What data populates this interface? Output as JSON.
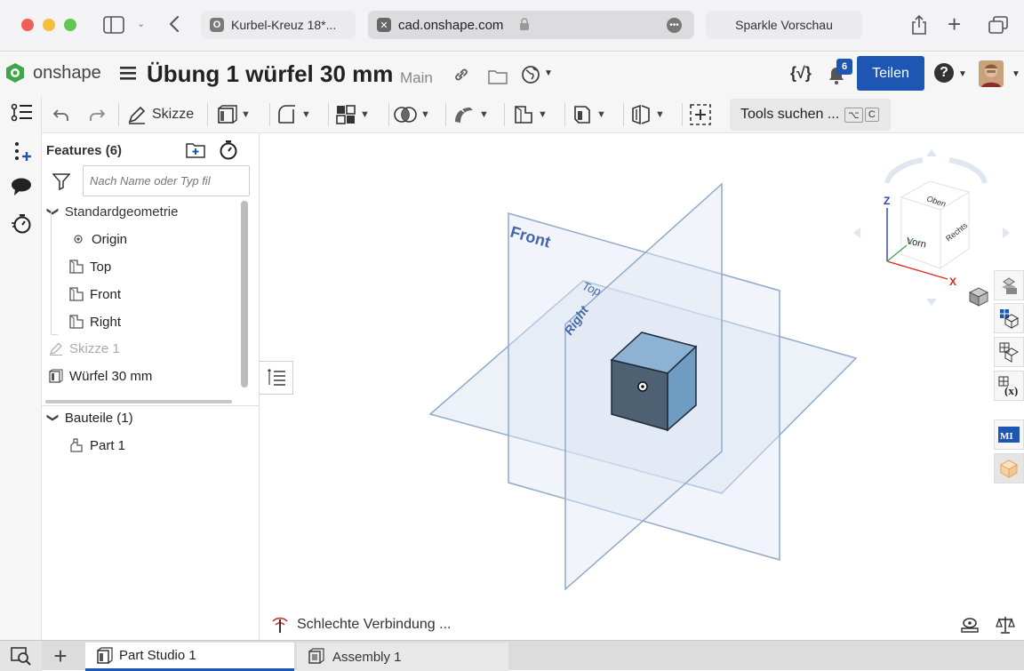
{
  "browser": {
    "tab1_label": "Kurbel-Kreuz 18*...",
    "tab1_favicon": "O",
    "address": "cad.onshape.com",
    "tab3_label": "Sparkle Vorschau",
    "favicon_x": "✕"
  },
  "header": {
    "logo_text": "onshape",
    "doc_title": "Übung 1 würfel 30 mm",
    "branch": "Main",
    "notification_count": "6",
    "share_label": "Teilen",
    "help_label": "?"
  },
  "toolbar": {
    "sketch_label": "Skizze",
    "search_tools_label": "Tools suchen ...",
    "shortcut_key_1": "⌥",
    "shortcut_key_2": "C"
  },
  "features": {
    "title": "Features (6)",
    "filter_placeholder": "Nach Name oder Typ fil",
    "default_geometry_label": "Standardgeometrie",
    "items": {
      "origin": "Origin",
      "top": "Top",
      "front": "Front",
      "right": "Right",
      "sketch": "Skizze 1",
      "extrude": "Würfel 30 mm"
    },
    "parts_header": "Bauteile (1)",
    "part1": "Part 1"
  },
  "viewport": {
    "plane_front": "Front",
    "plane_top": "Top",
    "plane_right": "Right",
    "viewcube_top": "Oben",
    "viewcube_front": "Vorn",
    "viewcube_right": "Rechts",
    "axis_z": "Z",
    "axis_y": "Y",
    "axis_x": "X",
    "status": "Schlechte Verbindung ..."
  },
  "bottom_tabs": {
    "part_studio": "Part Studio 1",
    "assembly": "Assembly 1",
    "add": "+"
  },
  "colors": {
    "accent": "#1e56b3",
    "plane_stroke": "#8fa9cc",
    "plane_fill": "#dfe7f3",
    "cube_front": "#4e6173",
    "cube_top": "#8db3d4",
    "cube_side": "#6e9cc2",
    "axis_x": "#d92a2a",
    "axis_y": "#3da33d",
    "axis_z": "#2b3fbf"
  }
}
